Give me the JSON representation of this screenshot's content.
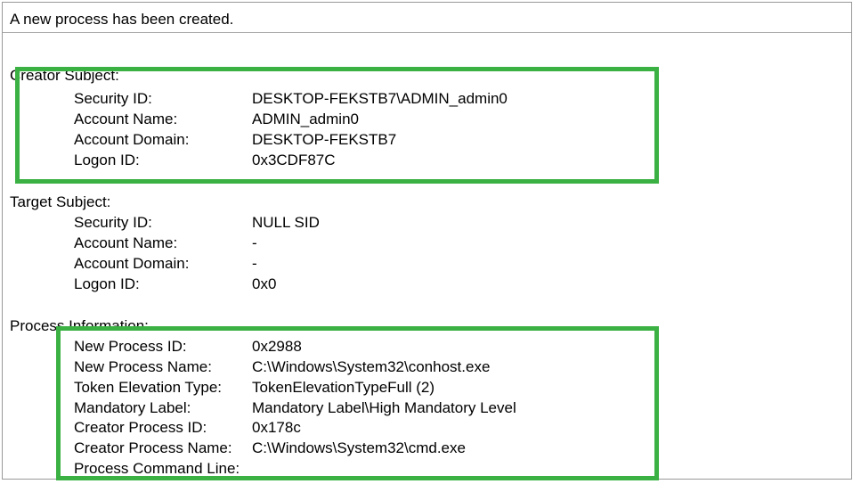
{
  "header": "A new process has been created.",
  "creator_subject": {
    "title": "Creator Subject:",
    "rows": [
      {
        "label": "Security ID:",
        "value": "DESKTOP-FEKSTB7\\ADMIN_admin0"
      },
      {
        "label": "Account Name:",
        "value": "ADMIN_admin0"
      },
      {
        "label": "Account Domain:",
        "value": "DESKTOP-FEKSTB7"
      },
      {
        "label": "Logon ID:",
        "value": "0x3CDF87C"
      }
    ]
  },
  "target_subject": {
    "title": "Target Subject:",
    "rows": [
      {
        "label": "Security ID:",
        "value": "NULL SID"
      },
      {
        "label": "Account Name:",
        "value": "-"
      },
      {
        "label": "Account Domain:",
        "value": "-"
      },
      {
        "label": "Logon ID:",
        "value": "0x0"
      }
    ]
  },
  "process_info": {
    "title": "Process Information:",
    "rows": [
      {
        "label": "New Process ID:",
        "value": "0x2988"
      },
      {
        "label": "New Process Name:",
        "value": "C:\\Windows\\System32\\conhost.exe"
      },
      {
        "label": "Token Elevation Type:",
        "value": "TokenElevationTypeFull (2)"
      },
      {
        "label": "Mandatory Label:",
        "value": "Mandatory Label\\High Mandatory Level"
      },
      {
        "label": "Creator Process ID:",
        "value": "0x178c"
      },
      {
        "label": "Creator Process Name:",
        "value": "C:\\Windows\\System32\\cmd.exe"
      }
    ],
    "truncated_row_label": "Process Command Line:"
  }
}
